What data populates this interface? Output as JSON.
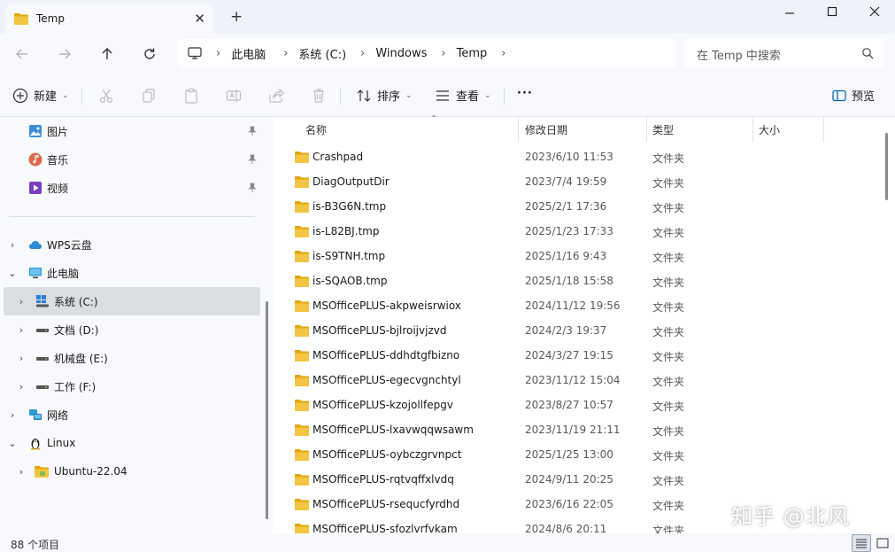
{
  "window": {
    "tab_title": "Temp",
    "tab_close": "✕",
    "new_tab": "+",
    "minimize": "—",
    "maximize": "☐",
    "close": "✕"
  },
  "address": {
    "breadcrumbs": [
      "此电脑",
      "系统 (C:)",
      "Windows",
      "Temp"
    ],
    "search_placeholder": "在 Temp 中搜索"
  },
  "toolbar": {
    "new_label": "新建",
    "sort_label": "排序",
    "view_label": "查看",
    "more_label": "···",
    "preview_label": "预览"
  },
  "sidebar": {
    "quick_access": [
      {
        "label": "图片",
        "icon": "pictures-icon"
      },
      {
        "label": "音乐",
        "icon": "music-icon"
      },
      {
        "label": "视频",
        "icon": "videos-icon"
      }
    ],
    "tree": [
      {
        "label": "WPS云盘",
        "icon": "cloud-icon",
        "chevron": "›"
      },
      {
        "label": "此电脑",
        "icon": "this-pc-icon",
        "chevron": "⌄"
      },
      {
        "label": "系统 (C:)",
        "icon": "windows-drive-icon",
        "chevron": "›"
      },
      {
        "label": "文档 (D:)",
        "icon": "drive-icon",
        "chevron": "›"
      },
      {
        "label": "机械盘 (E:)",
        "icon": "drive-icon",
        "chevron": "›"
      },
      {
        "label": "工作 (F:)",
        "icon": "drive-icon",
        "chevron": "›"
      },
      {
        "label": "网络",
        "icon": "network-icon",
        "chevron": "›"
      },
      {
        "label": "Linux",
        "icon": "linux-icon",
        "chevron": "⌄"
      },
      {
        "label": "Ubuntu-22.04",
        "icon": "folder-icon",
        "chevron": "›"
      }
    ]
  },
  "table": {
    "columns": [
      "名称",
      "修改日期",
      "类型",
      "大小"
    ],
    "sort_indicator": "⌃",
    "rows": [
      {
        "name": "Crashpad",
        "date": "2023/6/10 11:53",
        "type": "文件夹"
      },
      {
        "name": "DiagOutputDir",
        "date": "2023/7/4 19:59",
        "type": "文件夹"
      },
      {
        "name": "is-B3G6N.tmp",
        "date": "2025/2/1 17:36",
        "type": "文件夹"
      },
      {
        "name": "is-L82BJ.tmp",
        "date": "2025/1/23 17:33",
        "type": "文件夹"
      },
      {
        "name": "is-S9TNH.tmp",
        "date": "2025/1/16 9:43",
        "type": "文件夹"
      },
      {
        "name": "is-SQAOB.tmp",
        "date": "2025/1/18 15:58",
        "type": "文件夹"
      },
      {
        "name": "MSOfficePLUS-akpweisrwiox",
        "date": "2024/11/12 19:56",
        "type": "文件夹"
      },
      {
        "name": "MSOfficePLUS-bjlroijvjzvd",
        "date": "2024/2/3 19:37",
        "type": "文件夹"
      },
      {
        "name": "MSOfficePLUS-ddhdtgfbizno",
        "date": "2024/3/27 19:15",
        "type": "文件夹"
      },
      {
        "name": "MSOfficePLUS-egecvgnchtyl",
        "date": "2023/11/12 15:04",
        "type": "文件夹"
      },
      {
        "name": "MSOfficePLUS-kzojollfepgv",
        "date": "2023/8/27 10:57",
        "type": "文件夹"
      },
      {
        "name": "MSOfficePLUS-lxavwqqwsawm",
        "date": "2023/11/19 21:11",
        "type": "文件夹"
      },
      {
        "name": "MSOfficePLUS-oybczgrvnpct",
        "date": "2025/1/25 13:00",
        "type": "文件夹"
      },
      {
        "name": "MSOfficePLUS-rqtvqffxlvdq",
        "date": "2024/9/11 20:25",
        "type": "文件夹"
      },
      {
        "name": "MSOfficePLUS-rsequcfyrdhd",
        "date": "2023/6/16 22:05",
        "type": "文件夹"
      },
      {
        "name": "MSOfficePLUS-sfozlvrfvkam",
        "date": "2024/8/6 20:11",
        "type": "文件夹"
      }
    ]
  },
  "status": {
    "item_count": "88 个项目"
  },
  "watermark": "知乎 @北风",
  "colors": {
    "accent": "#0067c0",
    "folder": "#f4c542",
    "folder_dark": "#e2a70c"
  }
}
